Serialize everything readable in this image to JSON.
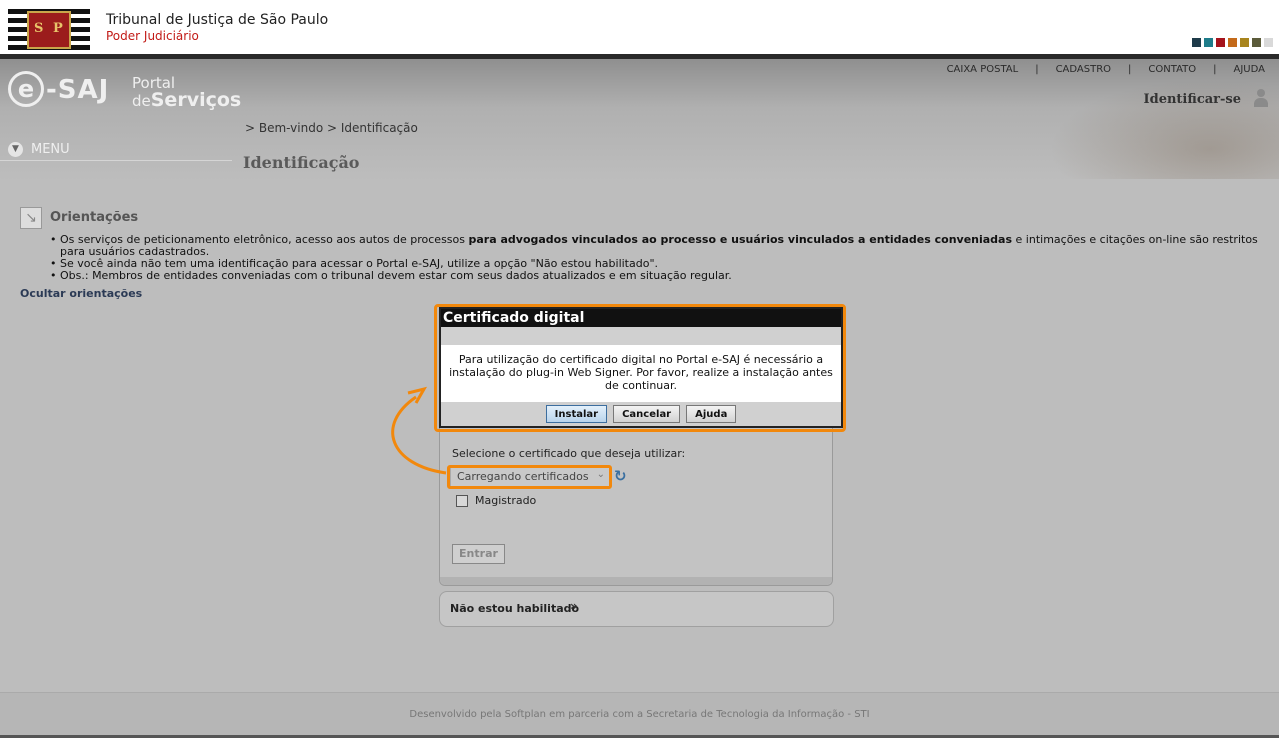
{
  "header": {
    "court_title": "Tribunal de Justiça de São Paulo",
    "court_subtitle": "Poder Judiciário",
    "seal_letters": [
      "S",
      "P"
    ],
    "swatches": [
      "#1e3b4a",
      "#1e7c8a",
      "#a5131c",
      "#c46a1a",
      "#a8841d",
      "#5b5b3a",
      "#d9d9d9"
    ]
  },
  "portal": {
    "logo_e": "e",
    "logo_saj": "-SAJ",
    "portal_line1": "Portal",
    "portal_line2_prefix": "de",
    "portal_line2_main": "Serviços"
  },
  "topnav": {
    "items": [
      "CAIXA POSTAL",
      "CADASTRO",
      "CONTATO",
      "AJUDA"
    ],
    "separator": "|"
  },
  "identify_link": "Identificar-se",
  "breadcrumb": "> Bem-vindo > Identificação",
  "menu_label": "MENU",
  "page_title": "Identificação",
  "orientations": {
    "title": "Orientações",
    "item1_pre": "Os serviços de peticionamento eletrônico, acesso aos autos de processos ",
    "item1_bold": "para advogados vinculados ao processo e usuários vinculados a entidades conveniadas",
    "item1_post": " e intimações e citações on-line são restritos para usuários cadastrados.",
    "item2": "Se você ainda não tem uma identificação para acessar o Portal e-SAJ, utilize a opção \"Não estou habilitado\".",
    "item3": "Obs.: Membros de entidades conveniadas com o tribunal devem estar com seus dados atualizados e em situação regular.",
    "hide_link": "Ocultar orientações"
  },
  "dialog": {
    "title": "Certificado digital",
    "message": "Para utilização do certificado digital no Portal e-SAJ é necessário a instalação do plug-in Web Signer. Por favor, realize a instalação antes de continuar.",
    "install_label": "Instalar",
    "cancel_label": "Cancelar",
    "help_label": "Ajuda"
  },
  "login": {
    "cert_label": "Selecione o certificado que deseja utilizar:",
    "cert_select_value": "Carregando certificados",
    "magistrado_label": "Magistrado",
    "enter_label": "Entrar"
  },
  "not_enabled_label": "Não estou habilitado",
  "footer_text": "Desenvolvido pela Softplan em parceria com a Secretaria de Tecnologia da Informação - STI"
}
